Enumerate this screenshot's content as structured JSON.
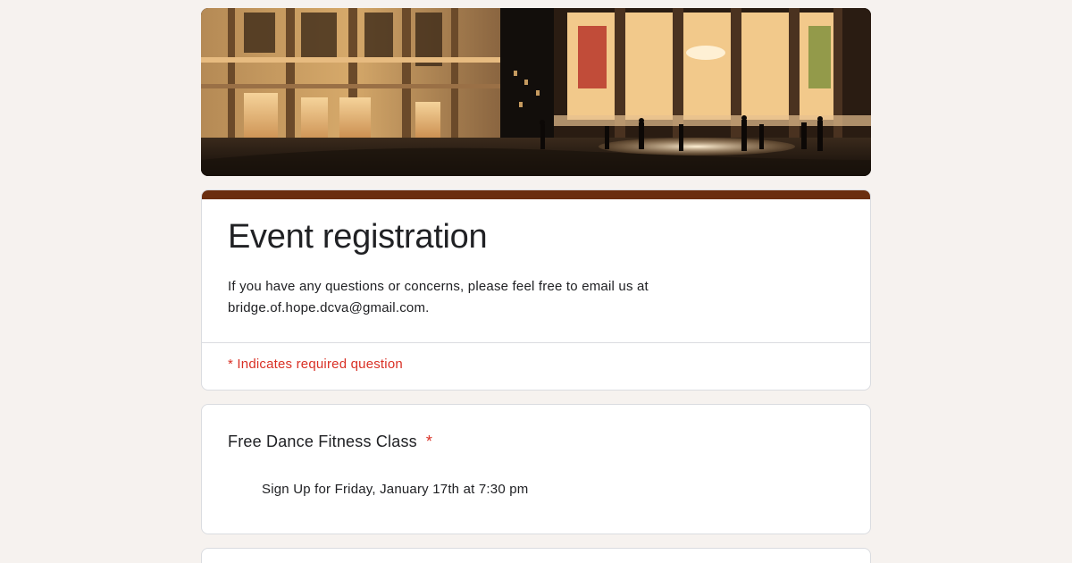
{
  "form": {
    "title": "Event registration",
    "description": "If you have any questions or concerns, please feel free to email us at bridge.of.hope.dcva@gmail.com.",
    "required_note": "* Indicates required question",
    "accent_color": "#6b2e0f",
    "background_color": "#f6f2ef",
    "required_color": "#d93025"
  },
  "banner": {
    "image": "night-plaza-theater-building-photo"
  },
  "questions": [
    {
      "title": "Free Dance Fitness Class",
      "required_marker": "*",
      "options": [
        {
          "label": "Sign Up for Friday, January 17th at 7:30 pm"
        }
      ]
    }
  ]
}
